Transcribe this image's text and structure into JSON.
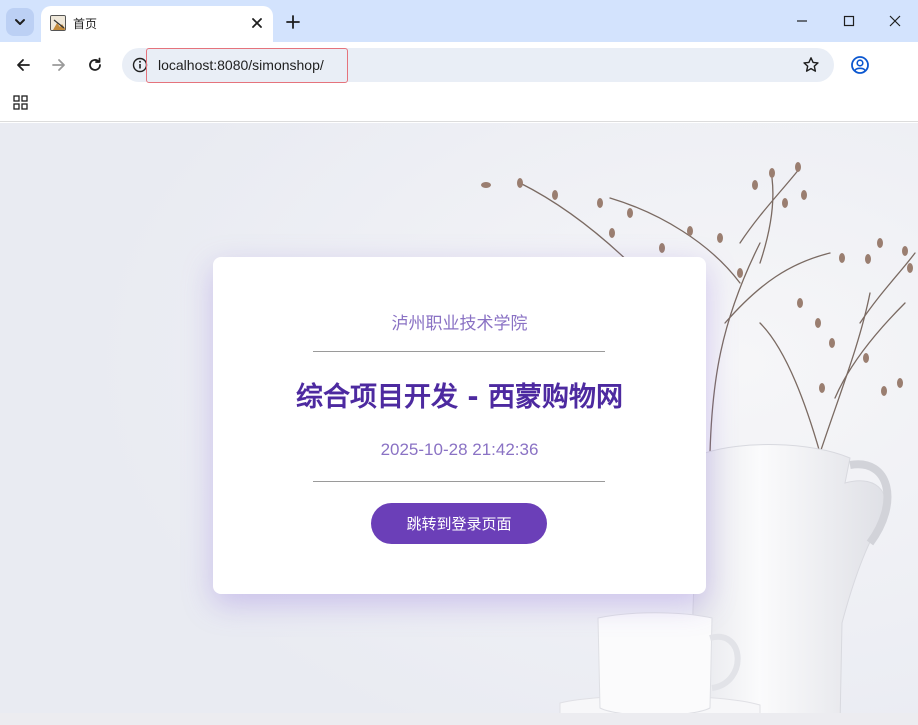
{
  "browser": {
    "tab": {
      "title": "首页"
    },
    "address": {
      "url": "localhost:8080/simonshop/"
    }
  },
  "page": {
    "school": "泸州职业技术学院",
    "title": "综合项目开发 - 西蒙购物网",
    "datetime": "2025-10-28 21:42:36",
    "button_label": "跳转到登录页面"
  },
  "colors": {
    "accent": "#6b3fb8",
    "title": "#4d2aa0",
    "subtle_text": "#8a72c4",
    "tabstrip": "#d3e3fd",
    "omnibox": "#e9eef6"
  },
  "icons": {
    "tab_search": "chevron-down-icon",
    "favicon": "image-icon",
    "tab_close": "close-icon",
    "new_tab": "plus-icon",
    "minimize": "minimize-icon",
    "maximize": "maximize-icon",
    "close_window": "close-icon",
    "back": "arrow-left-icon",
    "forward": "arrow-right-icon",
    "reload": "reload-icon",
    "site_info": "info-icon",
    "bookmark": "star-icon",
    "profile": "account-icon",
    "apps": "apps-grid-icon"
  }
}
